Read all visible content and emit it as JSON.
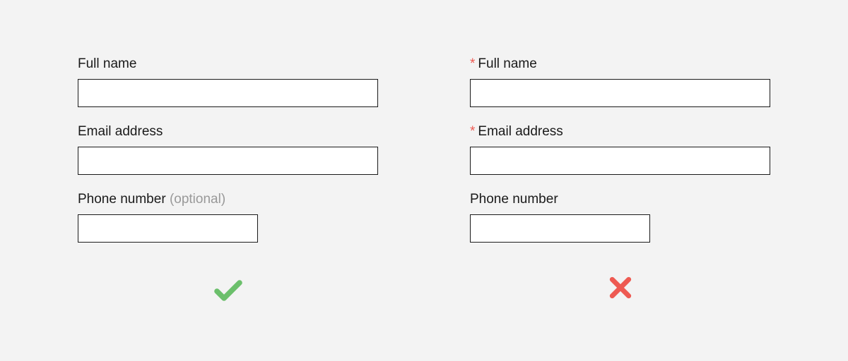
{
  "good": {
    "fields": [
      {
        "label": "Full name",
        "optional": "",
        "width": "full"
      },
      {
        "label": "Email address",
        "optional": "",
        "width": "full"
      },
      {
        "label": "Phone number",
        "optional": "(optional)",
        "width": "short"
      }
    ],
    "status": "correct"
  },
  "bad": {
    "required_marker": "*",
    "fields": [
      {
        "label": "Full name",
        "required": true,
        "width": "full"
      },
      {
        "label": "Email address",
        "required": true,
        "width": "full"
      },
      {
        "label": "Phone number",
        "required": false,
        "width": "short"
      }
    ],
    "status": "incorrect"
  },
  "colors": {
    "check": "#6bbf6b",
    "cross": "#ee5a52"
  }
}
